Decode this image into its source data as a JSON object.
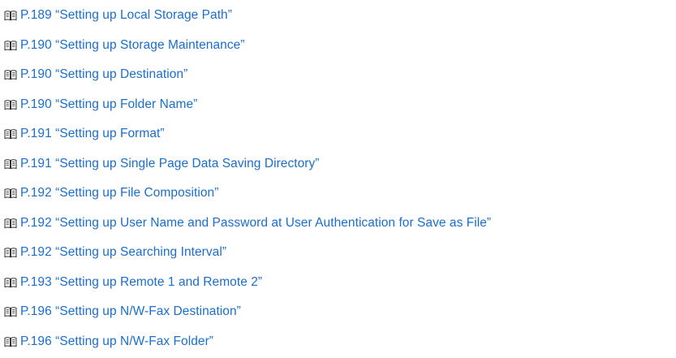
{
  "references": [
    {
      "icon": "book-icon",
      "text": "P.189 “Setting up Local Storage Path”"
    },
    {
      "icon": "book-icon",
      "text": "P.190 “Setting up Storage Maintenance”"
    },
    {
      "icon": "book-icon",
      "text": "P.190 “Setting up Destination”"
    },
    {
      "icon": "book-icon",
      "text": "P.190 “Setting up Folder Name”"
    },
    {
      "icon": "book-icon",
      "text": "P.191 “Setting up Format”"
    },
    {
      "icon": "book-icon",
      "text": "P.191 “Setting up Single Page Data Saving Directory”"
    },
    {
      "icon": "book-icon",
      "text": "P.192 “Setting up File Composition”"
    },
    {
      "icon": "book-icon",
      "text": "P.192 “Setting up User Name and Password at User Authentication for Save as File”"
    },
    {
      "icon": "book-icon",
      "text": "P.192 “Setting up Searching Interval”"
    },
    {
      "icon": "book-icon",
      "text": "P.193 “Setting up Remote 1 and Remote 2”"
    },
    {
      "icon": "book-icon",
      "text": "P.196 “Setting up N/W-Fax Destination”"
    },
    {
      "icon": "book-icon",
      "text": "P.196 “Setting up N/W-Fax Folder”"
    }
  ],
  "colors": {
    "link": "#1a6ecc",
    "icon": "#333333",
    "background": "#ffffff"
  }
}
